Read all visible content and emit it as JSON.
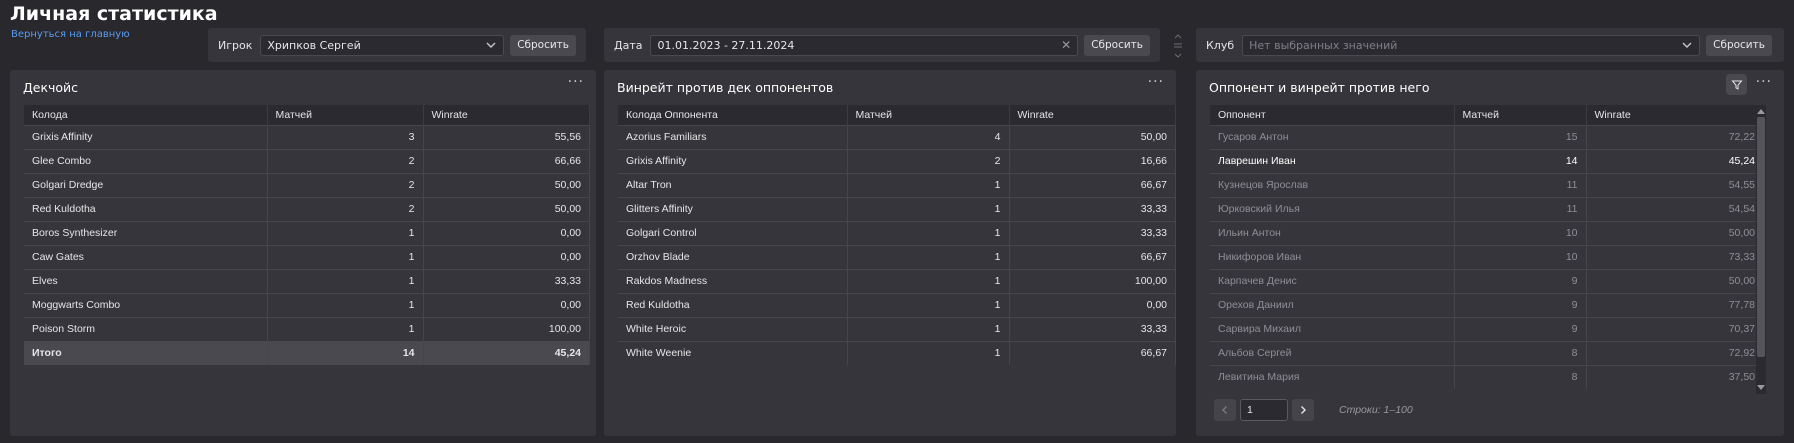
{
  "header": {
    "title": "Личная статистика",
    "back_link": "Вернуться на главную"
  },
  "filters": {
    "player": {
      "label": "Игрок",
      "value": "Хрипков Сергей",
      "reset": "Сбросить"
    },
    "date": {
      "label": "Дата",
      "value": "01.01.2023 - 27.11.2024",
      "reset": "Сбросить"
    },
    "club": {
      "label": "Клуб",
      "placeholder": "Нет выбранных значений",
      "reset": "Сбросить"
    }
  },
  "decks_panel": {
    "title": "Декчойс",
    "columns": [
      "Колода",
      "Матчей",
      "Winrate"
    ],
    "rows": [
      [
        "Grixis Affinity",
        "3",
        "55,56"
      ],
      [
        "Glee Combo",
        "2",
        "66,66"
      ],
      [
        "Golgari Dredge",
        "2",
        "50,00"
      ],
      [
        "Red Kuldotha",
        "2",
        "50,00"
      ],
      [
        "Boros Synthesizer",
        "1",
        "0,00"
      ],
      [
        "Caw Gates",
        "1",
        "0,00"
      ],
      [
        "Elves",
        "1",
        "33,33"
      ],
      [
        "Moggwarts Combo",
        "1",
        "0,00"
      ],
      [
        "Poison Storm",
        "1",
        "100,00"
      ]
    ],
    "total": [
      "Итого",
      "14",
      "45,24"
    ]
  },
  "opp_decks_panel": {
    "title": "Винрейт против дек оппонентов",
    "columns": [
      "Колода Оппонента",
      "Матчей",
      "Winrate"
    ],
    "rows": [
      [
        "Azorius Familiars",
        "4",
        "50,00"
      ],
      [
        "Grixis Affinity",
        "2",
        "16,66"
      ],
      [
        "Altar Tron",
        "1",
        "66,67"
      ],
      [
        "Glitters Affinity",
        "1",
        "33,33"
      ],
      [
        "Golgari Control",
        "1",
        "33,33"
      ],
      [
        "Orzhov Blade",
        "1",
        "66,67"
      ],
      [
        "Rakdos Madness",
        "1",
        "100,00"
      ],
      [
        "Red Kuldotha",
        "1",
        "0,00"
      ],
      [
        "White Heroic",
        "1",
        "33,33"
      ],
      [
        "White Weenie",
        "1",
        "66,67"
      ]
    ]
  },
  "opponents_panel": {
    "title": "Оппонент и винрейт против него",
    "columns": [
      "Оппонент",
      "Матчей",
      "Winrate"
    ],
    "rows": [
      [
        "Гусаров Антон",
        "15",
        "72,22"
      ],
      [
        "Лаврешин Иван",
        "14",
        "45,24"
      ],
      [
        "Кузнецов Ярослав",
        "11",
        "54,55"
      ],
      [
        "Юрковский Илья",
        "11",
        "54,54"
      ],
      [
        "Ильин Антон",
        "10",
        "50,00"
      ],
      [
        "Никифоров Иван",
        "10",
        "73,33"
      ],
      [
        "Карпачев Денис",
        "9",
        "50,00"
      ],
      [
        "Орехов Даниил",
        "9",
        "77,78"
      ],
      [
        "Сарвира Михаил",
        "9",
        "70,37"
      ],
      [
        "Альбов Сергей",
        "8",
        "72,92"
      ],
      [
        "Левитина Мария",
        "8",
        "37,50"
      ]
    ],
    "highlighted_row": 1,
    "pager": {
      "page": "1",
      "rows_info": "Строки: 1–100"
    }
  },
  "icons": {
    "more": "more-dots-icon",
    "filter": "filter-icon",
    "caret": "chevron-down-icon",
    "clear": "clear-icon",
    "prev": "chevron-left-icon",
    "next": "chevron-right-icon"
  },
  "colors": {
    "background": "#29282d",
    "panel": "#36353b",
    "link": "#5a9bf0",
    "total_row": "#4a4950"
  }
}
